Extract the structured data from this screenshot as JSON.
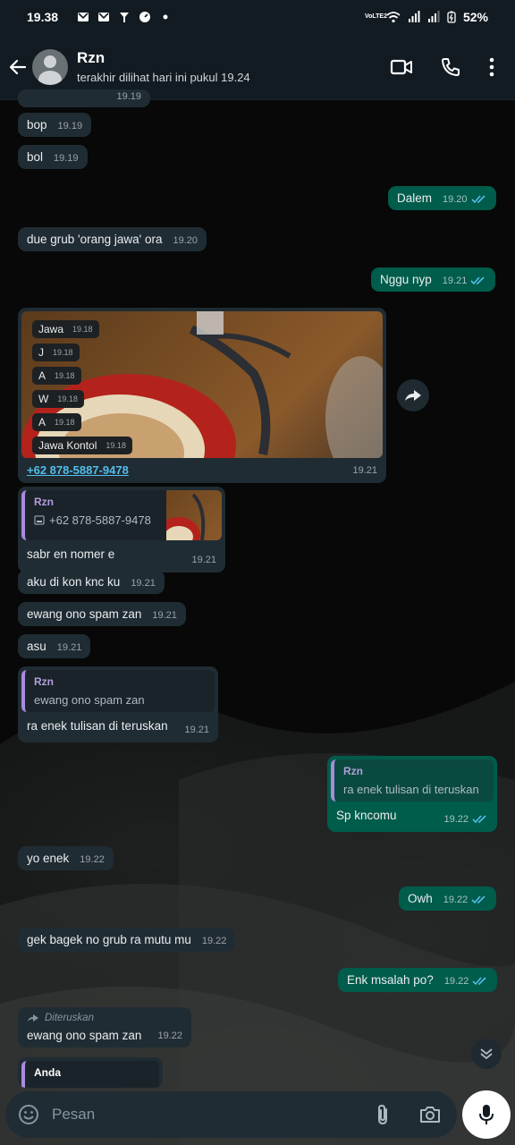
{
  "status_bar": {
    "time": "19.38",
    "battery": "52%",
    "network_label": "VoLTE2"
  },
  "header": {
    "name": "Rzn",
    "status": "terakhir dilihat hari ini pukul 19.24"
  },
  "messages": {
    "partial_time": "19.19",
    "m1": {
      "text": "bop",
      "time": "19.19"
    },
    "m2": {
      "text": "bol",
      "time": "19.19"
    },
    "m3": {
      "text": "Dalem",
      "time": "19.20"
    },
    "m4": {
      "text": "due grub 'orang jawa' ora",
      "time": "19.20"
    },
    "m5": {
      "text": "Nggu nyp",
      "time": "19.21"
    },
    "m6": {
      "chips": [
        {
          "text": "Jawa",
          "time": "19.18"
        },
        {
          "text": "J",
          "time": "19.18"
        },
        {
          "text": "A",
          "time": "19.18"
        },
        {
          "text": "W",
          "time": "19.18"
        },
        {
          "text": "A",
          "time": "19.18"
        },
        {
          "text": "Jawa Kontol",
          "time": "19.18"
        }
      ],
      "caption": "+62 878-5887-9478",
      "time": "19.21"
    },
    "m7": {
      "quote_author": "Rzn",
      "quote_text": "+62 878-5887-9478",
      "text": "sabr en nomer e",
      "time": "19.21"
    },
    "m8": {
      "text": "aku di kon knc ku",
      "time": "19.21"
    },
    "m9": {
      "text": "ewang ono spam zan",
      "time": "19.21"
    },
    "m10": {
      "text": "asu",
      "time": "19.21"
    },
    "m11": {
      "quote_author": "Rzn",
      "quote_text": "ewang ono spam zan",
      "text": "ra enek tulisan di teruskan",
      "time": "19.21"
    },
    "m12": {
      "quote_author": "Rzn",
      "quote_text": "ra enek tulisan di teruskan",
      "text": "Sp kncomu",
      "time": "19.22"
    },
    "m13": {
      "text": "yo enek",
      "time": "19.22"
    },
    "m14": {
      "text": "Owh",
      "time": "19.22"
    },
    "m15": {
      "text": "gek bagek no grub ra mutu mu",
      "time": "19.22"
    },
    "m16": {
      "text": "Enk msalah po?",
      "time": "19.22"
    },
    "m17": {
      "forward_label": "Diteruskan",
      "text": "ewang ono spam zan",
      "time": "19.22"
    },
    "m18": {
      "quote_author": "Anda"
    }
  },
  "composer": {
    "placeholder": "Pesan"
  },
  "colors": {
    "incoming": "#202c33",
    "outgoing": "#005c4b",
    "read_ticks": "#53bdeb",
    "quote_accent": "#a78bdc",
    "header_bg": "#121b22"
  },
  "icons": [
    "back-arrow-icon",
    "video-call-icon",
    "phone-icon",
    "more-vert-icon",
    "forward-icon",
    "chevron-down-icon",
    "emoji-icon",
    "attach-icon",
    "camera-icon",
    "mic-icon"
  ]
}
